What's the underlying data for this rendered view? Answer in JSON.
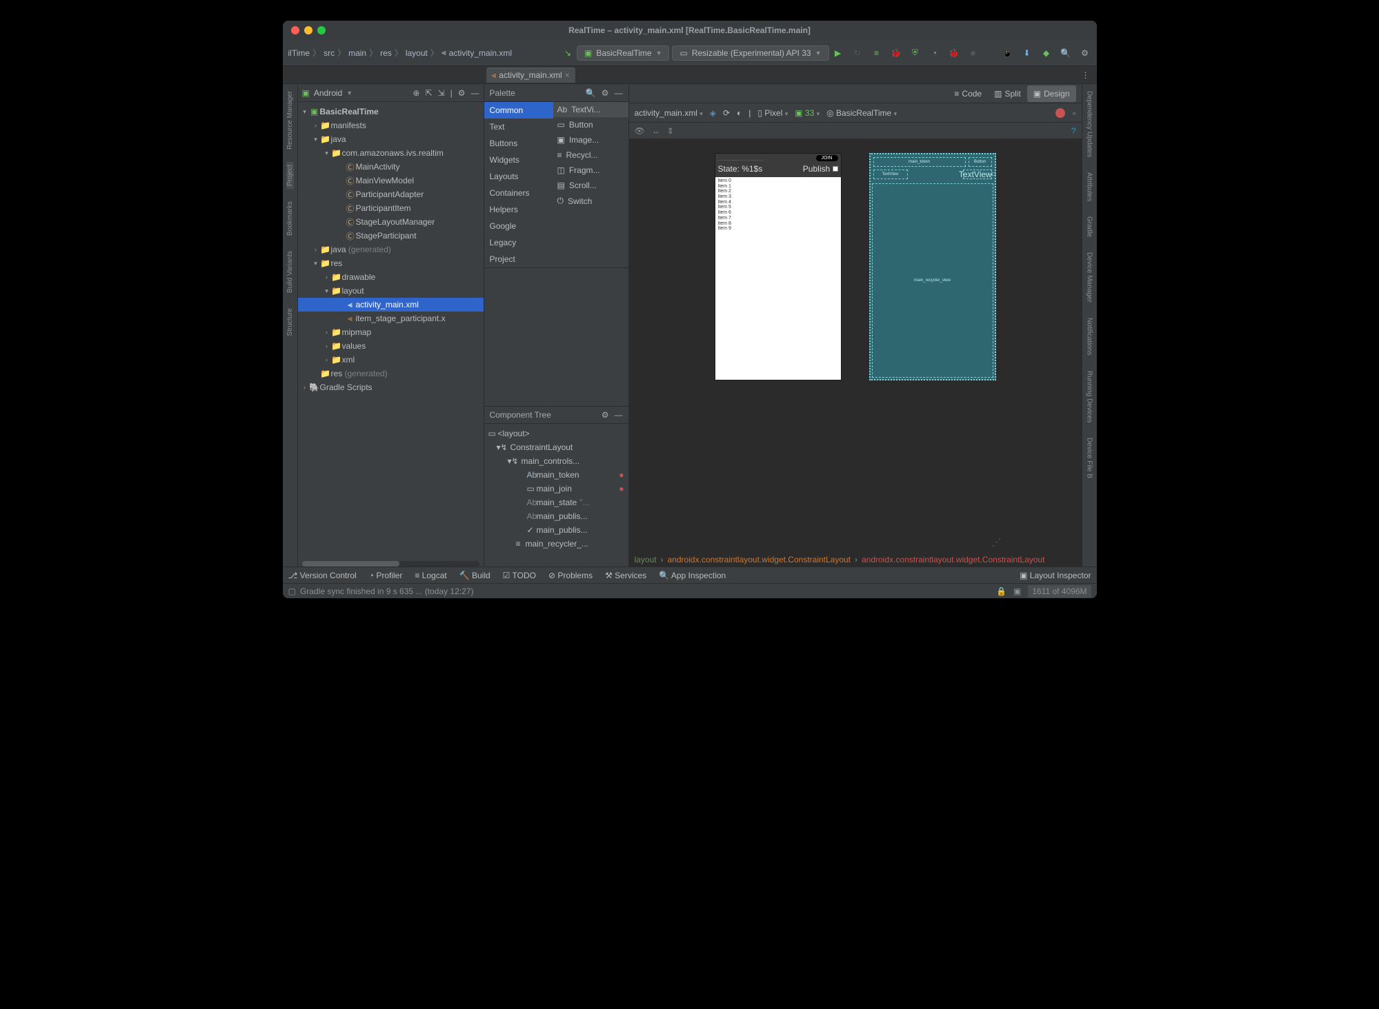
{
  "window": {
    "title": "RealTime – activity_main.xml [RealTime.BasicRealTime.main]"
  },
  "breadcrumb": [
    "ilTime",
    "src",
    "main",
    "res",
    "layout",
    "activity_main.xml"
  ],
  "runConfig": "BasicRealTime",
  "device": "Resizable (Experimental) API 33",
  "editorTab": "activity_main.xml",
  "sidebarHead": "Android",
  "leftRail": [
    "Resource Manager",
    "Project",
    "Bookmarks",
    "Build Variants",
    "Structure"
  ],
  "rightRail": [
    "Dependency Updates",
    "Attributes",
    "Gradle",
    "Device Manager",
    "Notifications",
    "Running Devices",
    "Device File B"
  ],
  "tree": {
    "root": "BasicRealTime",
    "manifests": "manifests",
    "java": "java",
    "pkg": "com.amazonaws.ivs.realtim",
    "classes": [
      "MainActivity",
      "MainViewModel",
      "ParticipantAdapter",
      "ParticipantItem",
      "StageLayoutManager",
      "StageParticipant"
    ],
    "javaGen": {
      "a": "java",
      "b": "(generated)"
    },
    "res": "res",
    "drawable": "drawable",
    "layout": "layout",
    "layoutFiles": [
      "activity_main.xml",
      "item_stage_participant.x"
    ],
    "mipmap": "mipmap",
    "values": "values",
    "xml": "xml",
    "resGen": {
      "a": "res",
      "b": "(generated)"
    },
    "gradle": "Gradle Scripts"
  },
  "palette": {
    "title": "Palette",
    "cats": [
      "Common",
      "Text",
      "Buttons",
      "Widgets",
      "Layouts",
      "Containers",
      "Helpers",
      "Google",
      "Legacy",
      "Project"
    ],
    "items": [
      "TextVi...",
      "Button",
      "Image...",
      "Recycl...",
      "Fragm...",
      "Scroll...",
      "Switch"
    ]
  },
  "componentTree": {
    "title": "Component Tree",
    "rows": [
      {
        "label": "<layout>",
        "indent": 0,
        "chev": ""
      },
      {
        "label": "ConstraintLayout",
        "indent": 1,
        "chev": "▾"
      },
      {
        "label": "main_controls...",
        "indent": 2,
        "chev": "▾"
      },
      {
        "label": "main_token",
        "indent": 3,
        "chev": "",
        "err": true
      },
      {
        "label": "main_join",
        "indent": 3,
        "chev": "",
        "err": true
      },
      {
        "label": "main_state",
        "indent": 3,
        "chev": "",
        "quote": "\"..."
      },
      {
        "label": "main_publis...",
        "indent": 3,
        "chev": ""
      },
      {
        "label": "main_publis...",
        "indent": 3,
        "chev": ""
      },
      {
        "label": "main_recycler_...",
        "indent": 2,
        "chev": ""
      }
    ]
  },
  "designToolbar": {
    "file": "activity_main.xml",
    "device": "Pixel",
    "api": "33",
    "theme": "BasicRealTime"
  },
  "viewModes": {
    "code": "Code",
    "split": "Split",
    "design": "Design"
  },
  "previewList": [
    "Item 0",
    "Item 1",
    "Item 2",
    "Item 3",
    "Item 4",
    "Item 5",
    "Item 6",
    "Item 7",
    "Item 8",
    "Item 9"
  ],
  "preview": {
    "join": "JOIN",
    "state": "State: %1$s",
    "publish": "Publish"
  },
  "blueprint": {
    "token": "main_token",
    "button": "Button",
    "textview1": "TextView",
    "textview2": "TextView",
    "recycler": "main_recycler_view"
  },
  "bcrumb2": {
    "a": "layout",
    "b": "androidx.constraintlayout.widget.ConstraintLayout",
    "c": "androidx.constraintlayout.widget.ConstraintLayout",
    "sep": "›"
  },
  "bottomTabs": [
    "Version Control",
    "Profiler",
    "Logcat",
    "Build",
    "TODO",
    "Problems",
    "Services",
    "App Inspection"
  ],
  "layoutInspector": "Layout Inspector",
  "status": {
    "msg": "Gradle sync finished in 9 s 635 ... (today 12:27)",
    "mem": "1611 of 4096M"
  }
}
